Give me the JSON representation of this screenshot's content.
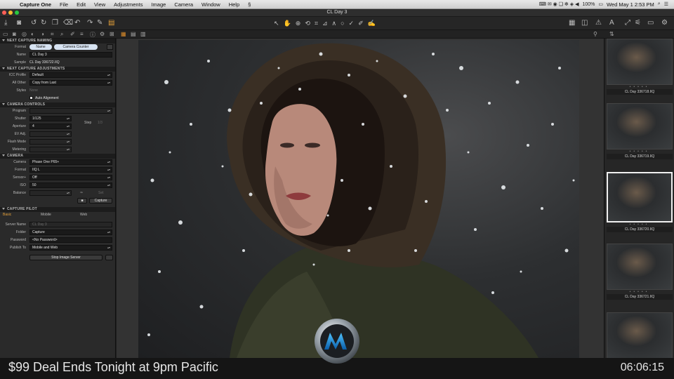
{
  "menubar": {
    "app": "Capture One",
    "items": [
      "File",
      "Edit",
      "View",
      "Adjustments",
      "Image",
      "Camera",
      "Window",
      "Help"
    ],
    "battery": "100%",
    "clock": "Wed May 1  2:53 PM"
  },
  "window": {
    "title": "CL Day 3"
  },
  "left_panel": {
    "next_capture_naming": {
      "header": "NEXT CAPTURE NAMING",
      "format_label": "Format",
      "format_tokens": [
        "Name",
        "Camera Counter"
      ],
      "name_label": "Name",
      "name_value": "CL Day 3",
      "sample_label": "Sample",
      "sample_value": "CL Day 336722.IIQ"
    },
    "next_capture_adjustments": {
      "header": "NEXT CAPTURE ADJUSTMENTS",
      "icc_label": "ICC Profile",
      "icc_value": "Default",
      "all_other_label": "All Other",
      "all_other_value": "Copy from Last",
      "styles_label": "Styles",
      "styles_value": "None",
      "auto_alignment": "Auto Alignment"
    },
    "camera_controls": {
      "header": "CAMERA CONTROLS",
      "program_label": "Program",
      "shutter_label": "Shutter",
      "shutter_value": "1/125",
      "aperture_label": "Aperture",
      "aperture_value": "4",
      "ev_label": "EV Adj.",
      "flash_label": "Flash Mode",
      "metering_label": "Metering",
      "step_label": "Step",
      "step_value": "1/3"
    },
    "camera": {
      "header": "CAMERA",
      "camera_label": "Camera",
      "camera_value": "Phase One P65+",
      "format_label": "Format",
      "format_value": "IIQ L",
      "sensor_label": "Sensor+",
      "sensor_value": "Off",
      "iso_label": "ISO",
      "iso_value": "50",
      "balance_label": "Balance",
      "set_label": "Set",
      "capture_button": "Capture"
    },
    "capture_pilot": {
      "header": "CAPTURE PILOT",
      "tabs": [
        "Basic",
        "Mobile",
        "Web"
      ],
      "server_name_label": "Server Name",
      "server_name_value": "CL Day 3",
      "folder_label": "Folder",
      "folder_value": "Capture",
      "password_label": "Password",
      "password_value": "<No Password>",
      "publish_label": "Publish To",
      "publish_value": "Mobile and Web",
      "stop_button": "Stop Image Server"
    }
  },
  "filmstrip": {
    "thumbs": [
      {
        "caption": "CL Day 336718.IIQ",
        "selected": false
      },
      {
        "caption": "CL Day 336719.IIQ",
        "selected": false
      },
      {
        "caption": "CL Day 336720.IIQ",
        "selected": true
      },
      {
        "caption": "CL Day 336721.IIQ",
        "selected": false
      },
      {
        "caption": "",
        "selected": false
      }
    ]
  },
  "overlay": {
    "deal_text": "$99 Deal Ends Tonight at 9pm Pacific",
    "timer": "06:06:15"
  },
  "colors": {
    "accent": "#e8a33a",
    "panel": "#2a2a2a",
    "close_dot": "#ff5f57",
    "min_dot": "#febc2e",
    "max_dot": "#28c840"
  }
}
